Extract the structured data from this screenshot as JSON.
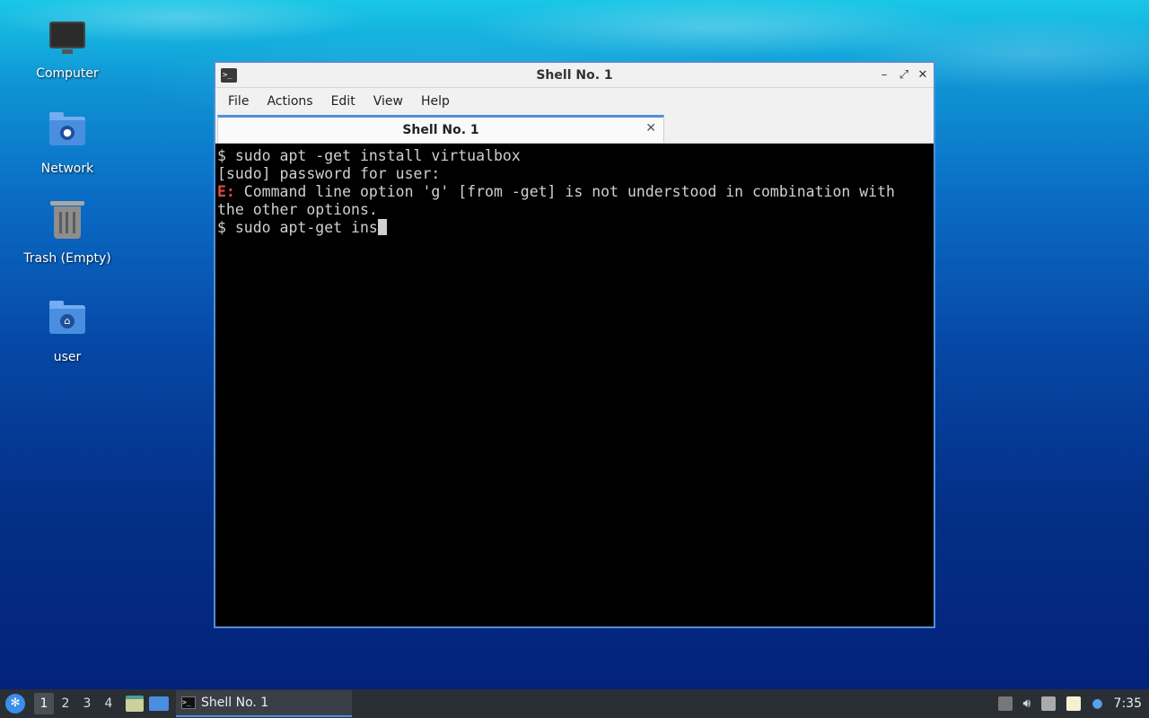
{
  "desktop": {
    "icons": [
      {
        "label": "Computer"
      },
      {
        "label": "Network"
      },
      {
        "label": "Trash (Empty)"
      },
      {
        "label": "user"
      }
    ]
  },
  "window": {
    "title": "Shell No. 1",
    "menu": [
      "File",
      "Actions",
      "Edit",
      "View",
      "Help"
    ],
    "tab_label": "Shell No. 1",
    "terminal": {
      "lines": [
        "$ sudo apt -get install virtualbox",
        "[sudo] password for user:"
      ],
      "error_prefix": "E:",
      "error_text": " Command line option 'g' [from -get] is not understood in combination with",
      "error_cont": "the other options.",
      "current_input": "$ sudo apt-get ins"
    }
  },
  "taskbar": {
    "workspaces": [
      "1",
      "2",
      "3",
      "4"
    ],
    "active_workspace": "1",
    "task_label": "Shell No. 1",
    "clock": "7:35"
  },
  "icons": {
    "logo": "menu-logo-icon",
    "files": "file-manager-icon",
    "show_desktop": "show-desktop-icon",
    "volume": "volume-icon",
    "network": "network-icon",
    "clipboard": "clipboard-icon",
    "notification": "notification-icon",
    "accent_color": "#4f8fd6"
  }
}
